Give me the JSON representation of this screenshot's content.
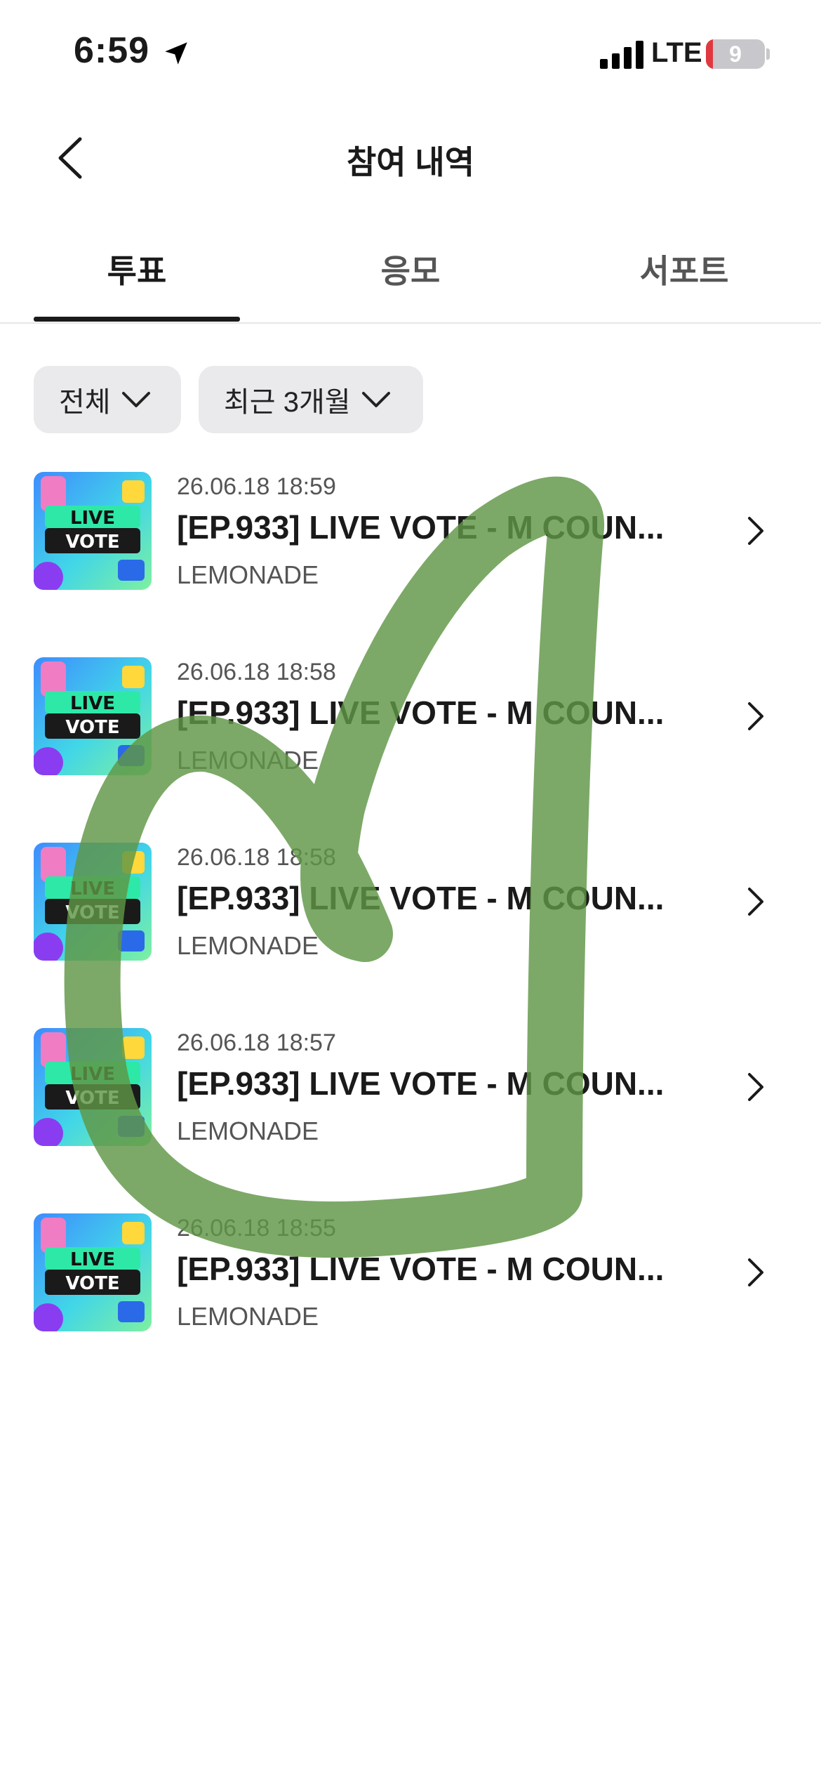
{
  "status_bar": {
    "time": "6:59",
    "carrier": "LTE",
    "battery": "9"
  },
  "header": {
    "title": "참여 내역"
  },
  "tabs": [
    {
      "label": "투표",
      "active": true
    },
    {
      "label": "응모",
      "active": false
    },
    {
      "label": "서포트",
      "active": false
    }
  ],
  "filters": {
    "category": "전체",
    "period": "최근 3개월"
  },
  "items": [
    {
      "date": "26.06.18 18:59",
      "title": "[EP.933] LIVE VOTE - M COUN...",
      "subtitle": "LEMONADE"
    },
    {
      "date": "26.06.18 18:58",
      "title": "[EP.933] LIVE VOTE - M COUN...",
      "subtitle": "LEMONADE"
    },
    {
      "date": "26.06.18 18:58",
      "title": "[EP.933] LIVE VOTE - M COUN...",
      "subtitle": "LEMONADE"
    },
    {
      "date": "26.06.18 18:57",
      "title": "[EP.933] LIVE VOTE - M COUN...",
      "subtitle": "LEMONADE"
    },
    {
      "date": "26.06.18 18:55",
      "title": "[EP.933] LIVE VOTE - M COUN...",
      "subtitle": "LEMONADE"
    }
  ],
  "thumbnail_text": [
    "LIVE",
    "VOTE"
  ],
  "icons": {
    "back": "chevron-left-icon",
    "location": "location-arrow-icon",
    "signal": "cellular-signal-icon",
    "dropdown": "chevron-down-icon",
    "row_action": "chevron-right-icon"
  },
  "colors": {
    "accent": "#1a1a1a",
    "chip_bg": "#eaeaec",
    "scribble": "#5f9645",
    "battery_low": "#e0383e"
  }
}
